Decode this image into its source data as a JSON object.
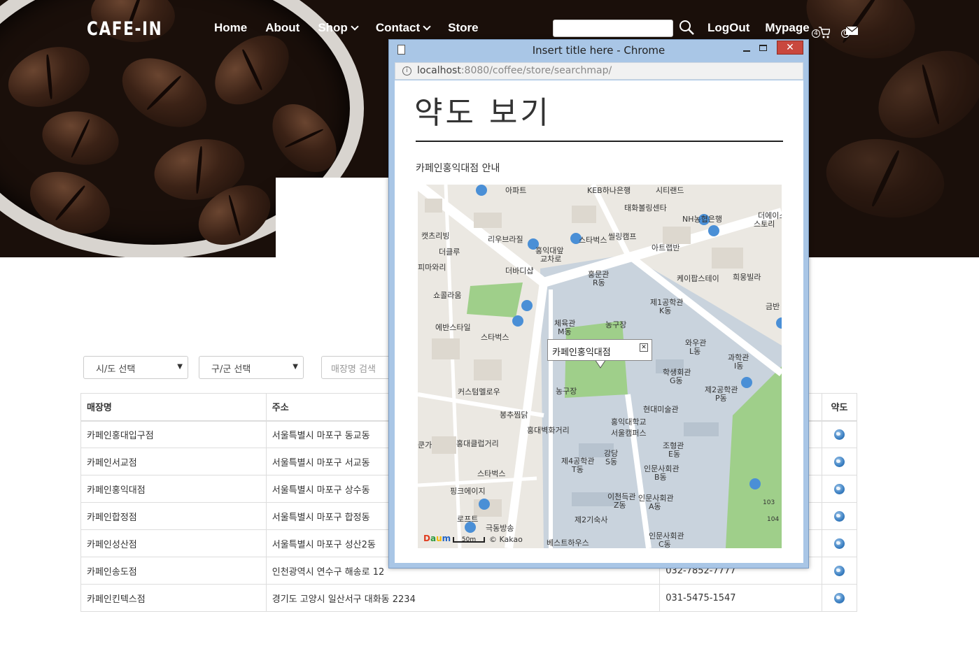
{
  "header": {
    "logo": "CAFE-IN",
    "nav": [
      {
        "label": "Home"
      },
      {
        "label": "About"
      },
      {
        "label": "Shop"
      },
      {
        "label": "Contact"
      },
      {
        "label": "Store"
      }
    ],
    "search_value": "",
    "logout_label": "LogOut",
    "mypage_label": "Mypage",
    "cart_count": "4",
    "mail_count": "0"
  },
  "filters": {
    "sido_label": "시/도 선택",
    "gugun_label": "구/군 선택",
    "store_search_placeholder": "매장명 검색"
  },
  "table": {
    "headers": {
      "name": "매장명",
      "address": "주소",
      "map": "약도"
    },
    "rows": [
      {
        "name": "카페인홍대입구점",
        "address": "서울특별시 마포구 동교동",
        "phone": ""
      },
      {
        "name": "카페인서교점",
        "address": "서울특별시 마포구 서교동",
        "phone": ""
      },
      {
        "name": "카페인홍익대점",
        "address": "서울특별시 마포구 상수동",
        "phone": ""
      },
      {
        "name": "카페인합정점",
        "address": "서울특별시 마포구 합정동",
        "phone": ""
      },
      {
        "name": "카페인성산점",
        "address": "서울특별시 마포구 성산2동",
        "phone": ""
      },
      {
        "name": "카페인송도점",
        "address": "인천광역시 연수구 해송로 12",
        "phone": "032-7852-7777"
      },
      {
        "name": "카페인킨텍스점",
        "address": "경기도 고양시 일산서구 대화동 2234",
        "phone": "031-5475-1547"
      }
    ]
  },
  "popup": {
    "window_title": "Insert title here - Chrome",
    "url_host": "localhost",
    "url_path": ":8080/coffee/store/searchmap/",
    "page_title": "약도 보기",
    "guide_text": "카페인홍익대점  안내",
    "info_window_label": "카페인홍익대점",
    "copyright": "© Kakao",
    "scale_label": "50m",
    "map_labels": [
      "KEB하나은행",
      "태화볼링센타",
      "NH농협은행",
      "더에이스",
      "스토리",
      "캣츠리빙",
      "리우브라질",
      "홍익대앞",
      "교차로",
      "스타벅스",
      "씰링캠프",
      "아트랩반",
      "더클루",
      "피마와리",
      "더바디샵",
      "홍문관",
      "R동",
      "케이팝스테이",
      "희웅빌라",
      "쇼콜라움",
      "제1공학관",
      "K동",
      "금반",
      "에반스타일",
      "체육관",
      "M동",
      "농구장",
      "스타벅스",
      "와우관",
      "L동",
      "과학관",
      "I동",
      "학생회관",
      "G동",
      "제2공학관",
      "P동",
      "커스텀멜로우",
      "농구장",
      "현대미술관",
      "봉추찜닭",
      "홍대벽화거리",
      "홍익대학교",
      "서울캠퍼스",
      "홍대클럽거리",
      "조형관",
      "E동",
      "강당",
      "S동",
      "제4공학관",
      "T동",
      "스타벅스",
      "인문사회관",
      "B동",
      "핑크에이지",
      "이천득관",
      "Z동",
      "인문사회관",
      "A동",
      "로프트",
      "극동방송",
      "제2기숙사",
      "인문사회관",
      "C동",
      "베스트하우스",
      "103",
      "104",
      "쿤가",
      "아파트",
      "시티랜드"
    ]
  },
  "colors": {
    "accent_blue": "#3a7fc2",
    "close_red": "#c9483e",
    "window_frame": "#a9c6e6",
    "campus_gray": "#c9d3dd",
    "park_green": "#9fcf8a"
  }
}
